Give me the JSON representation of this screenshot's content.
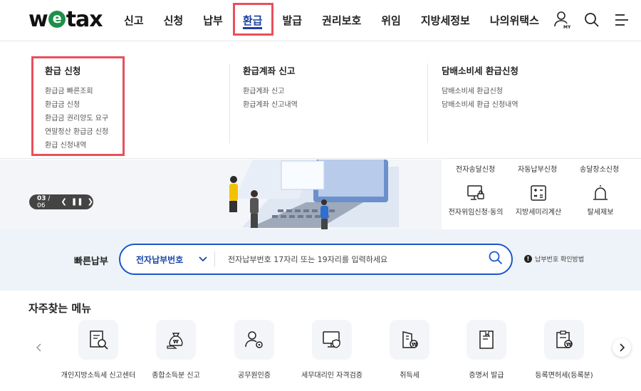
{
  "header": {
    "logo": {
      "pre": "w",
      "mid": "e",
      "post": "tax"
    },
    "nav": [
      "신고",
      "신청",
      "납부",
      "환급",
      "발급",
      "권리보호",
      "위임",
      "지방세정보",
      "나의위택스"
    ],
    "active_nav": "환급",
    "icons": [
      "my-user-icon",
      "search-icon",
      "menu-icon"
    ]
  },
  "mega_menu": {
    "columns": [
      {
        "title": "환급 신청",
        "items": [
          "환급금 빠른조회",
          "환급금 신청",
          "환급금 권리양도 요구",
          "연말정산 환급금 신청",
          "환급 신청내역"
        ]
      },
      {
        "title": "환급계좌 신고",
        "items": [
          "환급계좌 신고",
          "환급계좌 신고내역"
        ]
      },
      {
        "title": "담배소비세 환급신청",
        "items": [
          "담배소비세 환급신청",
          "담배소비세 환급 신청내역"
        ]
      }
    ]
  },
  "banner": {
    "counter_current": "03",
    "counter_total": "/ 06",
    "quick_links_top": [
      "전자송달신청",
      "자동납부신청",
      "송달장소신청"
    ],
    "quick_links": [
      {
        "label": "전자위임신청·동의",
        "icon": "monitor-lock-icon"
      },
      {
        "label": "지방세미리계산",
        "icon": "calculator-icon"
      },
      {
        "label": "탈세제보",
        "icon": "siren-icon"
      }
    ]
  },
  "quick_pay": {
    "title": "빠른납부",
    "select_value": "전자납부번호",
    "placeholder": "전자납부번호 17자리 또는 19자리를 입력하세요",
    "help": "납부번호 확인방법"
  },
  "frequent": {
    "title": "자주찾는 메뉴",
    "items": [
      {
        "label": "개인지방소득세 신고센터",
        "icon": "document-search-icon"
      },
      {
        "label": "종합소득분 신고",
        "icon": "money-bag-icon"
      },
      {
        "label": "공무원인증",
        "icon": "user-gear-icon"
      },
      {
        "label": "세무대리인 자격검증",
        "icon": "monitor-shield-icon"
      },
      {
        "label": "취득세",
        "icon": "building-coin-icon"
      },
      {
        "label": "증명서 발급",
        "icon": "certificate-icon"
      },
      {
        "label": "등록면허세(등록분)",
        "icon": "clipboard-coin-icon"
      }
    ]
  }
}
